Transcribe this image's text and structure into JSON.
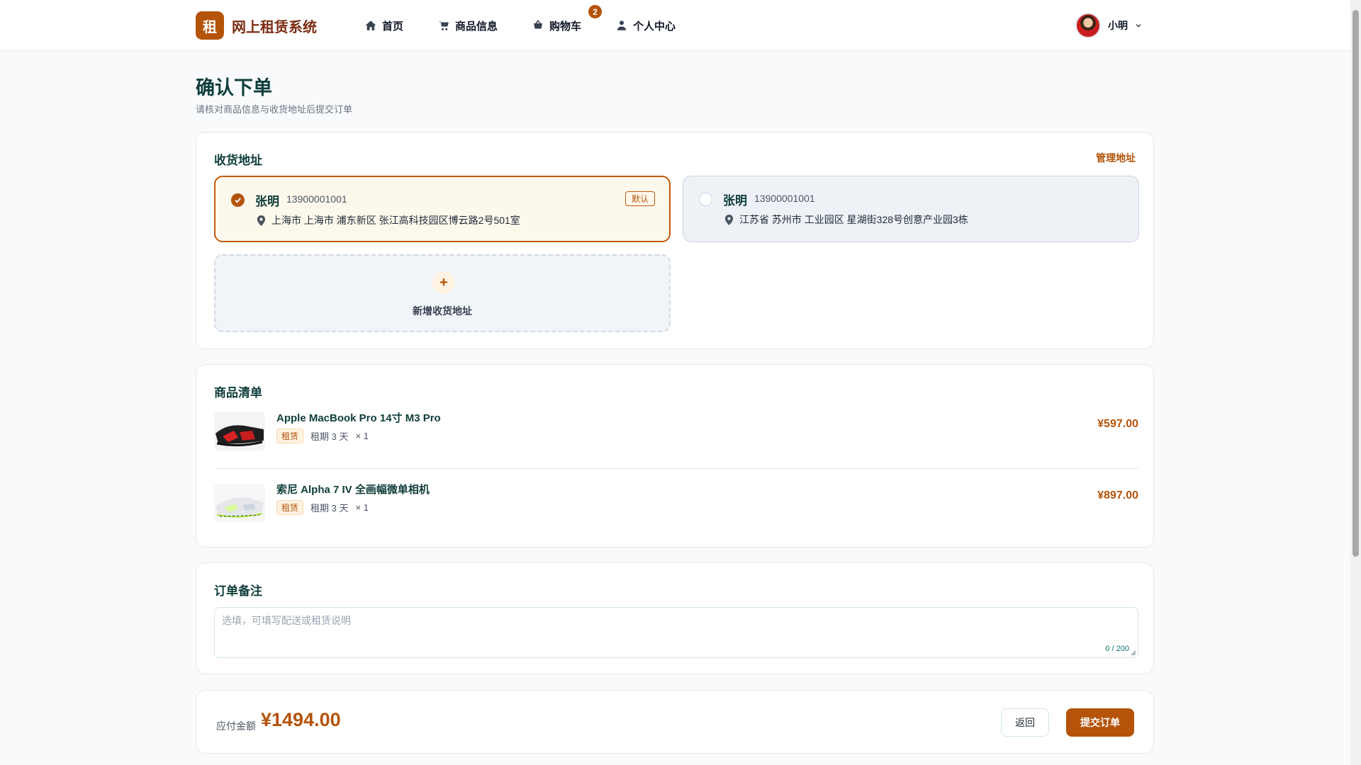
{
  "header": {
    "logo_char": "租",
    "brand": "网上租赁系统",
    "nav": [
      {
        "label": "首页",
        "icon": "home-icon"
      },
      {
        "label": "商品信息",
        "icon": "cart-icon"
      },
      {
        "label": "购物车",
        "icon": "basket-icon",
        "badge": "2"
      },
      {
        "label": "个人中心",
        "icon": "user-icon"
      }
    ],
    "user_name": "小明"
  },
  "page": {
    "title": "确认下单",
    "subtitle": "请核对商品信息与收货地址后提交订单"
  },
  "address": {
    "title": "收货地址",
    "manage_label": "管理地址",
    "items": [
      {
        "name": "张明",
        "phone": "13900001001",
        "detail": "上海市 上海市 浦东新区 张江高科技园区博云路2号501室",
        "tag": "默认",
        "selected": true
      },
      {
        "name": "张明",
        "phone": "13900001001",
        "detail": "江苏省 苏州市 工业园区 星湖街328号创意产业园3栋",
        "selected": false
      }
    ],
    "add_label": "新增收货地址"
  },
  "goods": {
    "title": "商品清单",
    "items": [
      {
        "name": "Apple MacBook Pro 14寸 M3 Pro",
        "tag": "租赁",
        "period": "租期 3 天",
        "qty": "× 1",
        "price": "¥597.00"
      },
      {
        "name": "索尼 Alpha 7 IV 全画幅微单相机",
        "tag": "租赁",
        "period": "租期 3 天",
        "qty": "× 1",
        "price": "¥897.00"
      }
    ]
  },
  "remark": {
    "title": "订单备注",
    "placeholder": "选填，可填写配送或租赁说明",
    "counter": "0 / 200"
  },
  "footer": {
    "total_label": "应付金额",
    "total": "¥1494.00",
    "back_label": "返回",
    "submit_label": "提交订单"
  },
  "colors": {
    "accent": "#b45309",
    "title": "#0f3d3a",
    "selected_bg": "#fdf8ec"
  }
}
